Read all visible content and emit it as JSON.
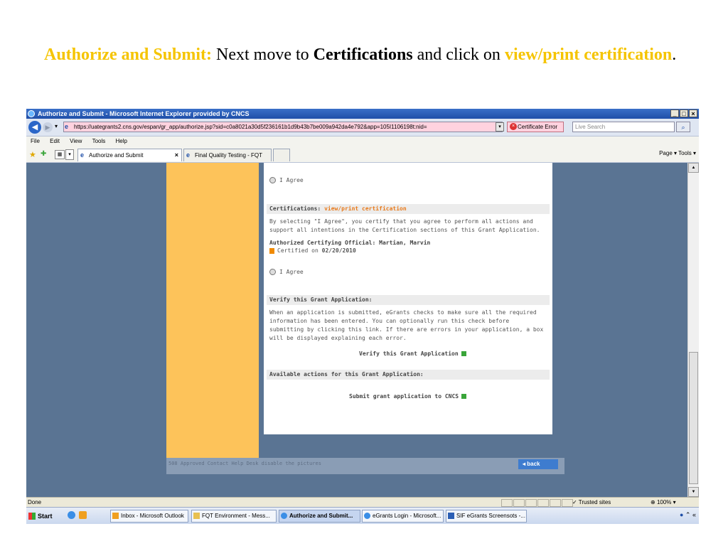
{
  "slide": {
    "heading": "Authorize and Submit:",
    "text1": " Next move to ",
    "bold": "Certifications",
    "text2": " and click on ",
    "link": "view/print certification",
    "end": "."
  },
  "browser": {
    "title": "Authorize and Submit - Microsoft Internet Explorer provided by CNCS",
    "window_buttons": [
      "_",
      "□",
      "×"
    ],
    "url": "https://uategrants2.cns.gov/espan/gr_app/authorize.jsp?sid=c0a8021a30d5f236161b1d9b43b7be009a942da4e792&app=105I1106198t:nid=",
    "certificate_error": "Certificate Error",
    "search_placeholder": "Live Search",
    "menu": [
      "File",
      "Edit",
      "View",
      "Tools",
      "Help"
    ],
    "tabs": [
      {
        "label": "Authorize and Submit",
        "active": true
      },
      {
        "label": "Final Quality Testing - FQT",
        "active": false
      }
    ],
    "command_bar": "Page ▾  Tools ▾",
    "status": "Done",
    "trusted": "Trusted sites",
    "zoom": "100%"
  },
  "page": {
    "agree1": "I Agree",
    "cert_header": "Certifications: ",
    "cert_link": "view/print certification",
    "cert_text": "By selecting \"I Agree\", you certify that you agree to perform all actions and support all intentions in the Certification sections of this Grant Application.",
    "official_label": "Authorized Certifying Official: Martian, Marvin",
    "certified_on_label": "Certified on ",
    "certified_date": "02/20/2010",
    "agree2": "I Agree",
    "verify_header": "Verify this Grant Application:",
    "verify_text": "When an application is submitted, eGrants checks to make sure all the required information has been entered. You can optionally run this check before submitting by clicking this link. If there are errors in your application, a box will be displayed explaining each error.",
    "verify_action": "Verify this Grant Application",
    "actions_header": "Available actions for this Grant Application:",
    "submit_action": "Submit grant application to CNCS",
    "footer_links": "508 Approved   Contact Help Desk   disable the pictures",
    "back": "back"
  },
  "taskbar": {
    "start": "Start",
    "items": [
      {
        "label": "Inbox - Microsoft Outlook"
      },
      {
        "label": "FQT Environment - Mess..."
      },
      {
        "label": "Authorize and Submit..."
      },
      {
        "label": "eGrants Login - Microsoft..."
      },
      {
        "label": "SIF eGrants Screensots -..."
      }
    ]
  }
}
